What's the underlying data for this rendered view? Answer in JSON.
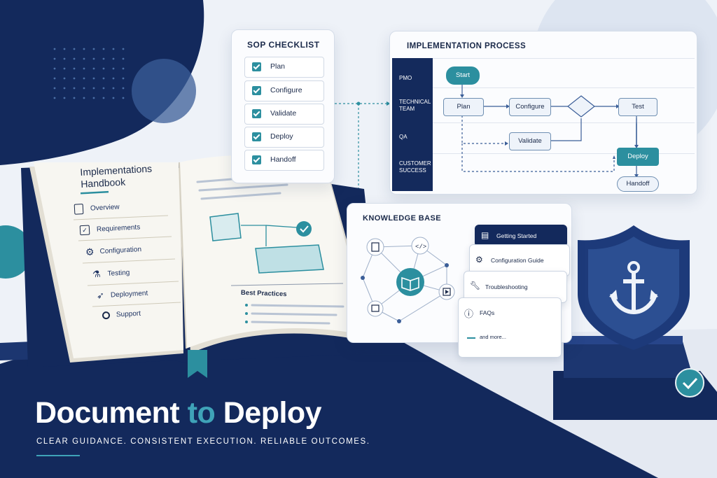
{
  "sop_checklist": {
    "title": "SOP CHECKLIST",
    "items": [
      "Plan",
      "Configure",
      "Validate",
      "Deploy",
      "Handoff"
    ]
  },
  "process": {
    "title": "IMPLEMENTATION PROCESS",
    "lanes": [
      "PMO",
      "TECHNICAL TEAM",
      "QA",
      "CUSTOMER SUCCESS"
    ],
    "nodes": {
      "start": "Start",
      "plan": "Plan",
      "configure": "Configure",
      "test": "Test",
      "validate": "Validate",
      "deploy": "Deploy",
      "handoff": "Handoff"
    }
  },
  "knowledge_base": {
    "title": "KNOWLEDGE BASE",
    "cards": [
      "Getting Started",
      "Configuration Guide",
      "Troubleshooting",
      "FAQs"
    ],
    "more": "and more..."
  },
  "handbook": {
    "title_line1": "Implementations",
    "title_line2": "Handbook",
    "toc": [
      "Overview",
      "Requirements",
      "Configuration",
      "Testing",
      "Deployment",
      "Support"
    ],
    "best_practices": "Best Practices"
  },
  "headline": {
    "part1": "Document ",
    "part2": "to",
    "part3": " Deploy",
    "tagline": "CLEAR GUIDANCE.  CONSISTENT EXECUTION.  RELIABLE OUTCOMES."
  },
  "colors": {
    "navy": "#13295c",
    "teal": "#2c8f9f",
    "light": "#eef2f8"
  }
}
